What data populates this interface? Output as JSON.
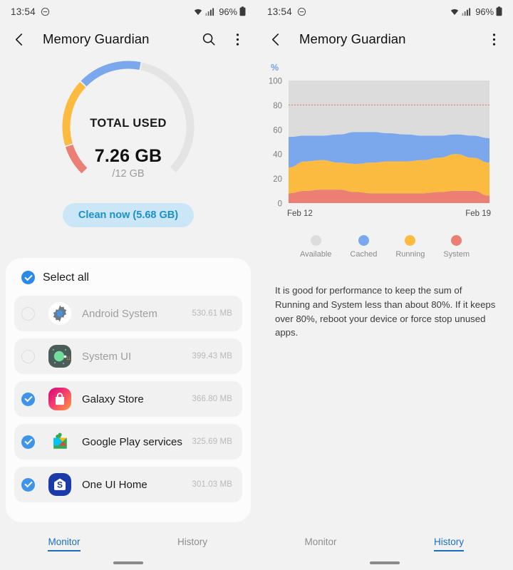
{
  "status_bar": {
    "time": "13:54",
    "dnd_icon": "do-not-disturb-icon",
    "wifi_icon": "wifi-icon",
    "signal_icon": "cellular-signal-icon",
    "battery_percent": "96%",
    "battery_icon": "battery-full-icon"
  },
  "app_bar": {
    "back_icon": "back-arrow-icon",
    "title": "Memory Guardian",
    "search_icon": "search-icon",
    "more_icon": "more-vertical-icon"
  },
  "monitor": {
    "gauge": {
      "center_label": "TOTAL USED",
      "used_value": "7.26 GB",
      "total_value": "/12 GB",
      "segments": [
        {
          "name": "System",
          "percent": 10.5,
          "color": "#ec7f73"
        },
        {
          "name": "Running",
          "percent": 22.5,
          "color": "#fabb40"
        },
        {
          "name": "Cached",
          "percent": 21.5,
          "color": "#7ba7ec"
        },
        {
          "name": "Available",
          "percent": 45.5,
          "color": "#e4e4e4"
        }
      ]
    },
    "clean_button": {
      "label": "Clean now (5.68 GB)",
      "bg_color": "#cbe7f7",
      "text_color": "#1a8fd0"
    },
    "select_all": {
      "label": "Select all",
      "checked": true
    },
    "apps": [
      {
        "name": "Android System",
        "size": "530.61 MB",
        "checked": false,
        "dimmed": true,
        "icon": "android-settings-gear-icon"
      },
      {
        "name": "System UI",
        "size": "399.43 MB",
        "checked": false,
        "dimmed": true,
        "icon": "system-ui-icon"
      },
      {
        "name": "Galaxy Store",
        "size": "366.80 MB",
        "checked": true,
        "dimmed": false,
        "icon": "galaxy-store-icon"
      },
      {
        "name": "Google Play services",
        "size": "325.69 MB",
        "checked": true,
        "dimmed": false,
        "icon": "google-play-services-icon"
      },
      {
        "name": "One UI Home",
        "size": "301.03 MB",
        "checked": true,
        "dimmed": false,
        "icon": "one-ui-home-icon"
      }
    ],
    "tabs": [
      {
        "label": "Monitor",
        "active": true
      },
      {
        "label": "History",
        "active": false
      }
    ]
  },
  "history": {
    "note": "It is good for performance to keep the sum of Running and System less than about 80%. If it keeps over 80%, reboot your device or force stop unused apps.",
    "legend": [
      {
        "label": "Available",
        "color": "#dcdcdc"
      },
      {
        "label": "Cached",
        "color": "#7ba7ec"
      },
      {
        "label": "Running",
        "color": "#fabb40"
      },
      {
        "label": "System",
        "color": "#ec7f73"
      }
    ],
    "tabs": [
      {
        "label": "Monitor",
        "active": false
      },
      {
        "label": "History",
        "active": true
      }
    ]
  },
  "chart_data": {
    "type": "area",
    "stacked": true,
    "title": "",
    "xlabel": "",
    "ylabel": "%",
    "ylim": [
      0,
      100
    ],
    "yticks": [
      0,
      20,
      40,
      60,
      80,
      100
    ],
    "xticks": [
      "Feb 12",
      "Feb 19"
    ],
    "x": [
      0,
      1,
      2,
      3,
      4,
      5,
      6,
      7,
      8,
      9,
      10,
      11,
      12
    ],
    "grid": false,
    "threshold_line": {
      "value": 80,
      "color": "#e08878",
      "style": "dotted"
    },
    "legend_position": "bottom",
    "series": [
      {
        "name": "System",
        "color": "#ec7f73",
        "values": [
          8,
          10,
          11,
          11,
          9,
          8,
          8,
          8,
          8,
          9,
          10,
          10,
          6
        ]
      },
      {
        "name": "Running",
        "color": "#fabb40",
        "values": [
          21,
          24,
          24,
          22,
          23,
          25,
          26,
          26,
          27,
          28,
          30,
          27,
          27
        ]
      },
      {
        "name": "Cached",
        "color": "#7ba7ec",
        "values": [
          25,
          21,
          20,
          23,
          26,
          25,
          23,
          22,
          20,
          18,
          16,
          18,
          20
        ]
      },
      {
        "name": "Available",
        "color": "#dcdcdc",
        "values": [
          46,
          45,
          45,
          44,
          42,
          42,
          43,
          44,
          45,
          45,
          44,
          45,
          47
        ]
      }
    ]
  }
}
